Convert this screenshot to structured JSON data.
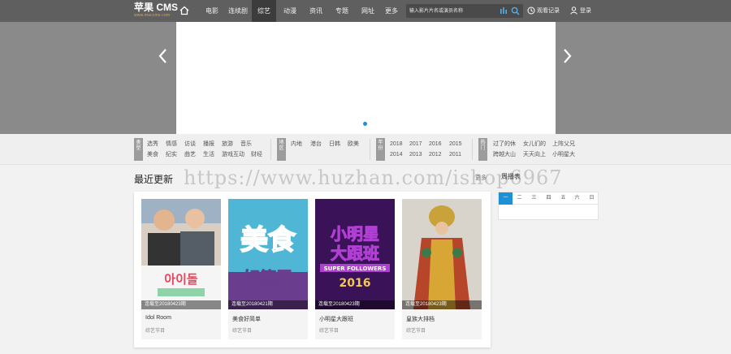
{
  "header": {
    "logo": "苹果 CMS",
    "logo_sub": "www.maccms.com",
    "nav": [
      "电影",
      "连续剧",
      "综艺",
      "动漫",
      "资讯",
      "专题",
      "网址",
      "更多"
    ],
    "active_nav": "综艺",
    "search_placeholder": "输入影片片名或演员名称",
    "history_label": "观看记录",
    "login_label": "登录"
  },
  "filters": {
    "group1_label": "类型",
    "group1_items": [
      "选秀",
      "情感",
      "访谈",
      "播报",
      "旅游",
      "音乐",
      "美食",
      "纪实",
      "曲艺",
      "生活",
      "游戏互动",
      "财经"
    ],
    "group2_label": "地区",
    "group2_items": [
      "内地",
      "港台",
      "日韩",
      "欧美"
    ],
    "group3_label": "年份",
    "group3_items": [
      "2018",
      "2017",
      "2016",
      "2015",
      "2014",
      "2013",
      "2012",
      "2011"
    ],
    "group4_label": "热门",
    "group4_items": [
      "过了的休",
      "女儿们的",
      "上阵父兄",
      "跨越大山",
      "天天向上",
      "小明星大"
    ]
  },
  "section": {
    "title": "最近更新",
    "more": "更多",
    "week_label": "周播表",
    "week_tabs": [
      "一",
      "二",
      "三",
      "四",
      "五",
      "六",
      "日"
    ]
  },
  "cards": [
    {
      "cap": "连载至20180423期",
      "title": "Idol Room",
      "sub": "综艺节目"
    },
    {
      "cap": "连载至20180421期",
      "title": "美食好简单",
      "sub": "综艺节目"
    },
    {
      "cap": "连载至20180423期",
      "title": "小明星大跟班",
      "sub": "综艺节目"
    },
    {
      "cap": "连载至20180423期",
      "title": "皇族大排档",
      "sub": "综艺节目"
    }
  ],
  "watermark": "https://www.huzhan.com/ishop6967",
  "colors": {
    "accent": "#1e90d6",
    "nav_bg": "#5f5f5f",
    "banner_bg": "#8a8a8a"
  }
}
